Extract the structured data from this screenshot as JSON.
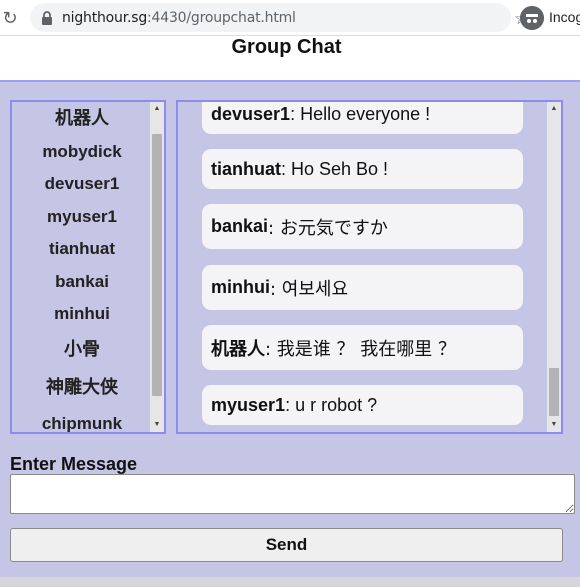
{
  "browser": {
    "url_host": "nighthour.sg",
    "url_rest": ":4430/groupchat.html",
    "profile_label": "Incog"
  },
  "page": {
    "title": "Group Chat"
  },
  "users": [
    {
      "name": "机器人"
    },
    {
      "name": "mobydick"
    },
    {
      "name": "devuser1"
    },
    {
      "name": "myuser1"
    },
    {
      "name": "tianhuat"
    },
    {
      "name": "bankai"
    },
    {
      "name": "minhui"
    },
    {
      "name": "小骨"
    },
    {
      "name": "神雕大侠"
    },
    {
      "name": "chipmunk"
    }
  ],
  "messages": [
    {
      "sender": "devuser1",
      "text": ": Hello everyone !"
    },
    {
      "sender": "tianhuat",
      "text": ": Ho Seh Bo !"
    },
    {
      "sender": "bankai",
      "text": ": お元気ですか"
    },
    {
      "sender": "minhui",
      "text": ": 여보세요"
    },
    {
      "sender": "机器人",
      "text": ": 我是谁 ？ 我在哪里 ？"
    },
    {
      "sender": "myuser1",
      "text": ": u r robot ?"
    }
  ],
  "form": {
    "label": "Enter Message",
    "input_value": "",
    "send_label": "Send"
  }
}
